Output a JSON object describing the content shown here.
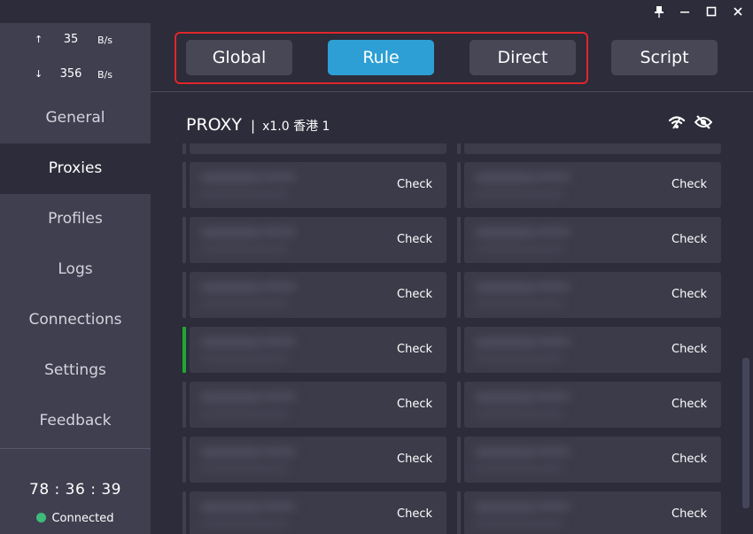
{
  "window": {
    "pin_glyph": "🖈",
    "minimize_glyph": "−",
    "maximize_glyph": "☐",
    "close_glyph": "✕"
  },
  "traffic": {
    "upload": {
      "arrow": "↑",
      "value": "35",
      "unit": "B/s"
    },
    "download": {
      "arrow": "↓",
      "value": "356",
      "unit": "B/s"
    }
  },
  "nav": [
    {
      "label": "General"
    },
    {
      "label": "Proxies"
    },
    {
      "label": "Profiles"
    },
    {
      "label": "Logs"
    },
    {
      "label": "Connections"
    },
    {
      "label": "Settings"
    },
    {
      "label": "Feedback"
    }
  ],
  "nav_active": "Proxies",
  "footer": {
    "timer": "78 : 36 : 39",
    "status": "Connected",
    "status_color": "#3dbb79"
  },
  "modes": {
    "global": "Global",
    "rule": "Rule",
    "direct": "Direct",
    "script": "Script",
    "active": "Rule",
    "active_color": "#2d9fd4",
    "highlight_color": "#e0262a"
  },
  "proxy_group": {
    "name": "PROXY",
    "separator": "|",
    "selected": "x1.0 香港 1",
    "icons": [
      "wifi-icon",
      "eye-off-icon"
    ]
  },
  "cards": {
    "check_label": "Check",
    "active_color": "#1fa82f"
  }
}
